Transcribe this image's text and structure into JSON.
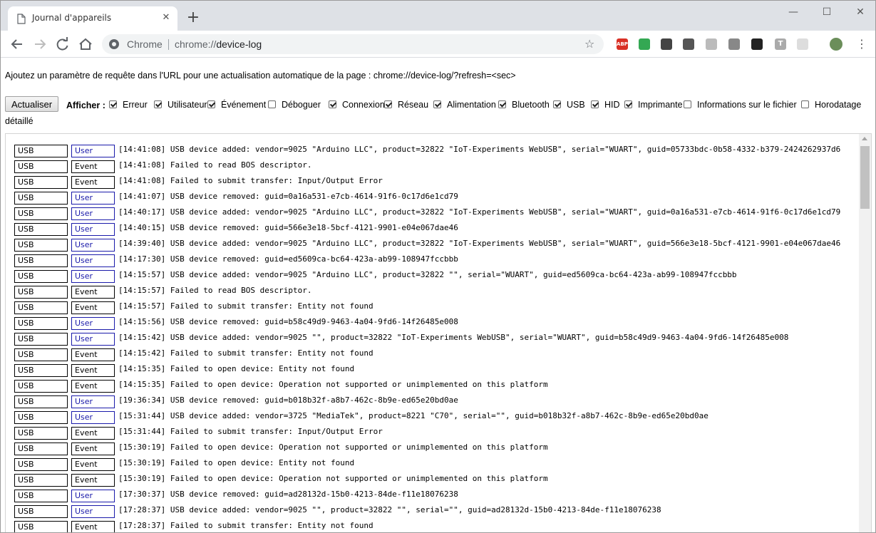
{
  "tab": {
    "title": "Journal d'appareils",
    "close_glyph": "✕",
    "new_tab_glyph": "+"
  },
  "window_controls": {
    "minimize": "—",
    "maximize": "☐",
    "close": "✕"
  },
  "omnibox": {
    "site_label": "Chrome",
    "url_scheme": "chrome://",
    "url_path": "device-log"
  },
  "toolbar": {
    "star_glyph": "☆",
    "menu_glyph": "⋮"
  },
  "extensions": [
    {
      "name": "adblock-icon",
      "color": "#d93025",
      "label": "ABP"
    },
    {
      "name": "color-wheel-icon",
      "color": "#34a853"
    },
    {
      "name": "clock-refresh-icon",
      "color": "#444444"
    },
    {
      "name": "mail-icon",
      "color": "#555555"
    },
    {
      "name": "page-icon",
      "color": "#bbbbbb"
    },
    {
      "name": "circle-icon",
      "color": "#888888"
    },
    {
      "name": "network-icon",
      "color": "#222222"
    },
    {
      "name": "t-icon",
      "color": "#aaaaaa",
      "label": "T"
    },
    {
      "name": "shield-icon",
      "color": "#dddddd"
    },
    {
      "name": "avatar",
      "color": "#6b8e5a"
    }
  ],
  "page": {
    "hint": "Ajoutez un paramètre de requête dans l'URL pour une actualisation automatique de la page : chrome://device-log/?refresh=<sec>",
    "refresh_label": "Actualiser",
    "show_label": "Afficher :",
    "filters": [
      {
        "label": "Erreur",
        "checked": true
      },
      {
        "label": "Utilisateur",
        "checked": true
      },
      {
        "label": "Événement",
        "checked": true
      },
      {
        "label": "Déboguer",
        "checked": false
      },
      {
        "label": "Connexion",
        "checked": true
      },
      {
        "label": "Réseau",
        "checked": true
      },
      {
        "label": "Alimentation",
        "checked": true
      },
      {
        "label": "Bluetooth",
        "checked": true
      },
      {
        "label": "USB",
        "checked": true
      },
      {
        "label": "HID",
        "checked": true
      },
      {
        "label": "Imprimante",
        "checked": true
      },
      {
        "label": "Informations sur le fichier",
        "checked": false
      },
      {
        "label": "Horodatage",
        "checked": false
      }
    ],
    "wrap_label": "détaillé"
  },
  "log": [
    {
      "src": "USB",
      "type": "User",
      "msg": "[14:41:08] USB device added: vendor=9025 \"Arduino LLC\", product=32822 \"IoT-Experiments WebUSB\", serial=\"WUART\", guid=05733bdc-0b58-4332-b379-2424262937d6"
    },
    {
      "src": "USB",
      "type": "Event",
      "msg": "[14:41:08] Failed to read BOS descriptor."
    },
    {
      "src": "USB",
      "type": "Event",
      "msg": "[14:41:08] Failed to submit transfer: Input/Output Error"
    },
    {
      "src": "USB",
      "type": "User",
      "msg": "[14:41:07] USB device removed: guid=0a16a531-e7cb-4614-91f6-0c17d6e1cd79"
    },
    {
      "src": "USB",
      "type": "User",
      "msg": "[14:40:17] USB device added: vendor=9025 \"Arduino LLC\", product=32822 \"IoT-Experiments WebUSB\", serial=\"WUART\", guid=0a16a531-e7cb-4614-91f6-0c17d6e1cd79"
    },
    {
      "src": "USB",
      "type": "User",
      "msg": "[14:40:15] USB device removed: guid=566e3e18-5bcf-4121-9901-e04e067dae46"
    },
    {
      "src": "USB",
      "type": "User",
      "msg": "[14:39:40] USB device added: vendor=9025 \"Arduino LLC\", product=32822 \"IoT-Experiments WebUSB\", serial=\"WUART\", guid=566e3e18-5bcf-4121-9901-e04e067dae46"
    },
    {
      "src": "USB",
      "type": "User",
      "msg": "[14:17:30] USB device removed: guid=ed5609ca-bc64-423a-ab99-108947fccbbb"
    },
    {
      "src": "USB",
      "type": "User",
      "msg": "[14:15:57] USB device added: vendor=9025 \"Arduino LLC\", product=32822 \"\", serial=\"WUART\", guid=ed5609ca-bc64-423a-ab99-108947fccbbb"
    },
    {
      "src": "USB",
      "type": "Event",
      "msg": "[14:15:57] Failed to read BOS descriptor."
    },
    {
      "src": "USB",
      "type": "Event",
      "msg": "[14:15:57] Failed to submit transfer: Entity not found"
    },
    {
      "src": "USB",
      "type": "User",
      "msg": "[14:15:56] USB device removed: guid=b58c49d9-9463-4a04-9fd6-14f26485e008"
    },
    {
      "src": "USB",
      "type": "User",
      "msg": "[14:15:42] USB device added: vendor=9025 \"\", product=32822 \"IoT-Experiments WebUSB\", serial=\"WUART\", guid=b58c49d9-9463-4a04-9fd6-14f26485e008"
    },
    {
      "src": "USB",
      "type": "Event",
      "msg": "[14:15:42] Failed to submit transfer: Entity not found"
    },
    {
      "src": "USB",
      "type": "Event",
      "msg": "[14:15:35] Failed to open device: Entity not found"
    },
    {
      "src": "USB",
      "type": "Event",
      "msg": "[14:15:35] Failed to open device: Operation not supported or unimplemented on this platform"
    },
    {
      "src": "USB",
      "type": "User",
      "msg": "[19:36:34] USB device removed: guid=b018b32f-a8b7-462c-8b9e-ed65e20bd0ae"
    },
    {
      "src": "USB",
      "type": "User",
      "msg": "[15:31:44] USB device added: vendor=3725 \"MediaTek\", product=8221 \"C70\", serial=\"\", guid=b018b32f-a8b7-462c-8b9e-ed65e20bd0ae"
    },
    {
      "src": "USB",
      "type": "Event",
      "msg": "[15:31:44] Failed to submit transfer: Input/Output Error"
    },
    {
      "src": "USB",
      "type": "Event",
      "msg": "[15:30:19] Failed to open device: Operation not supported or unimplemented on this platform"
    },
    {
      "src": "USB",
      "type": "Event",
      "msg": "[15:30:19] Failed to open device: Entity not found"
    },
    {
      "src": "USB",
      "type": "Event",
      "msg": "[15:30:19] Failed to open device: Operation not supported or unimplemented on this platform"
    },
    {
      "src": "USB",
      "type": "User",
      "msg": "[17:30:37] USB device removed: guid=ad28132d-15b0-4213-84de-f11e18076238"
    },
    {
      "src": "USB",
      "type": "User",
      "msg": "[17:28:37] USB device added: vendor=9025 \"\", product=32822 \"\", serial=\"\", guid=ad28132d-15b0-4213-84de-f11e18076238"
    },
    {
      "src": "USB",
      "type": "Event",
      "msg": "[17:28:37] Failed to submit transfer: Entity not found"
    }
  ]
}
